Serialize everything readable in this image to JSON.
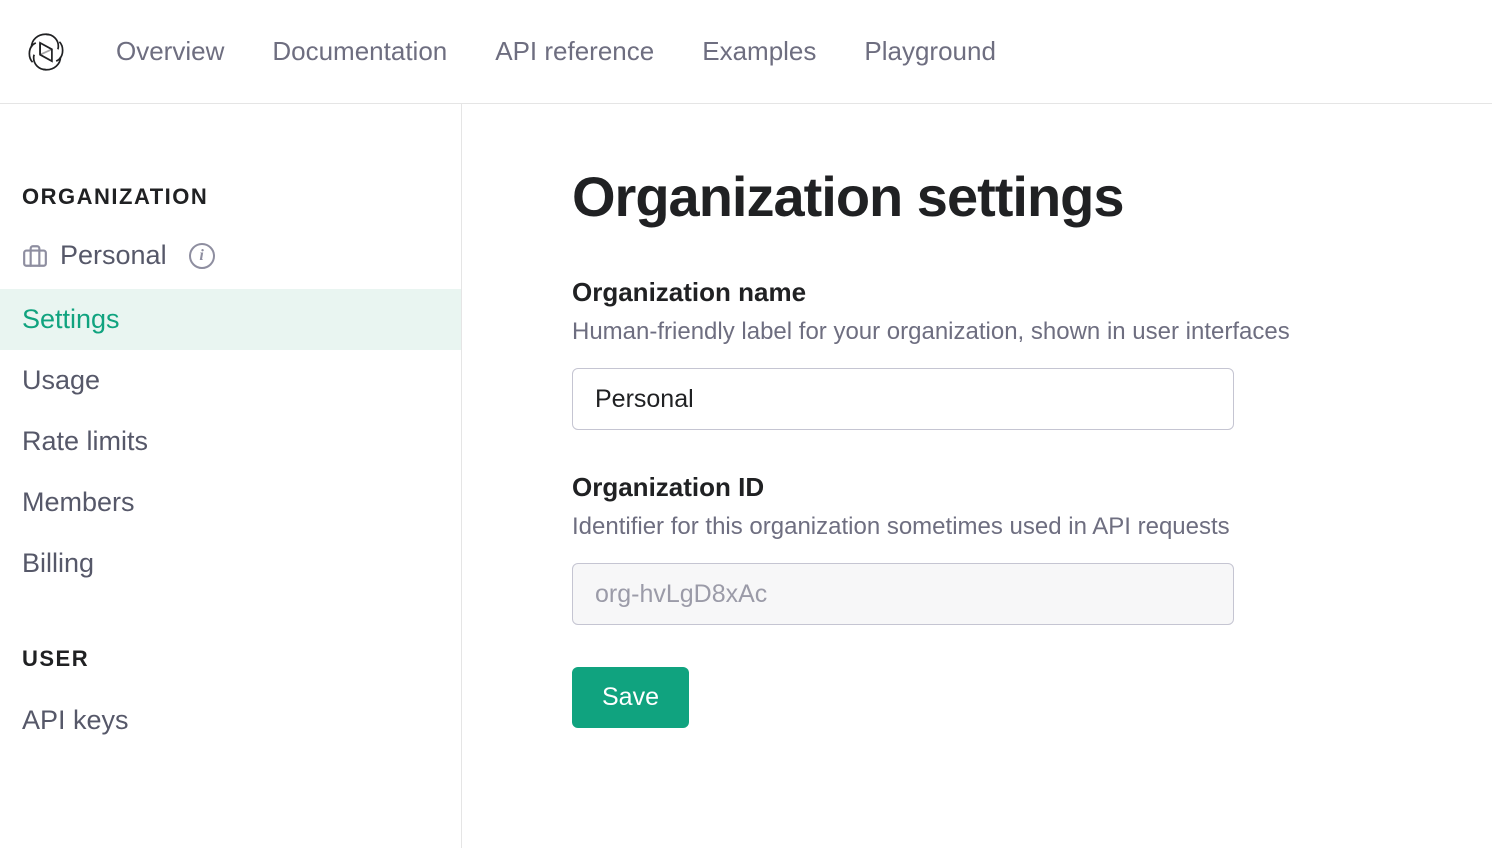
{
  "nav": {
    "items": [
      "Overview",
      "Documentation",
      "API reference",
      "Examples",
      "Playground"
    ]
  },
  "sidebar": {
    "org_section_title": "ORGANIZATION",
    "org_name": "Personal",
    "items": [
      "Settings",
      "Usage",
      "Rate limits",
      "Members",
      "Billing"
    ],
    "user_section_title": "USER",
    "user_items": [
      "API keys"
    ]
  },
  "main": {
    "title": "Organization settings",
    "org_name_label": "Organization name",
    "org_name_desc": "Human-friendly label for your organization, shown in user interfaces",
    "org_name_value": "Personal",
    "org_id_label": "Organization ID",
    "org_id_desc": "Identifier for this organization sometimes used in API requests",
    "org_id_value": "org-hvLgD8xAc",
    "save_label": "Save"
  }
}
